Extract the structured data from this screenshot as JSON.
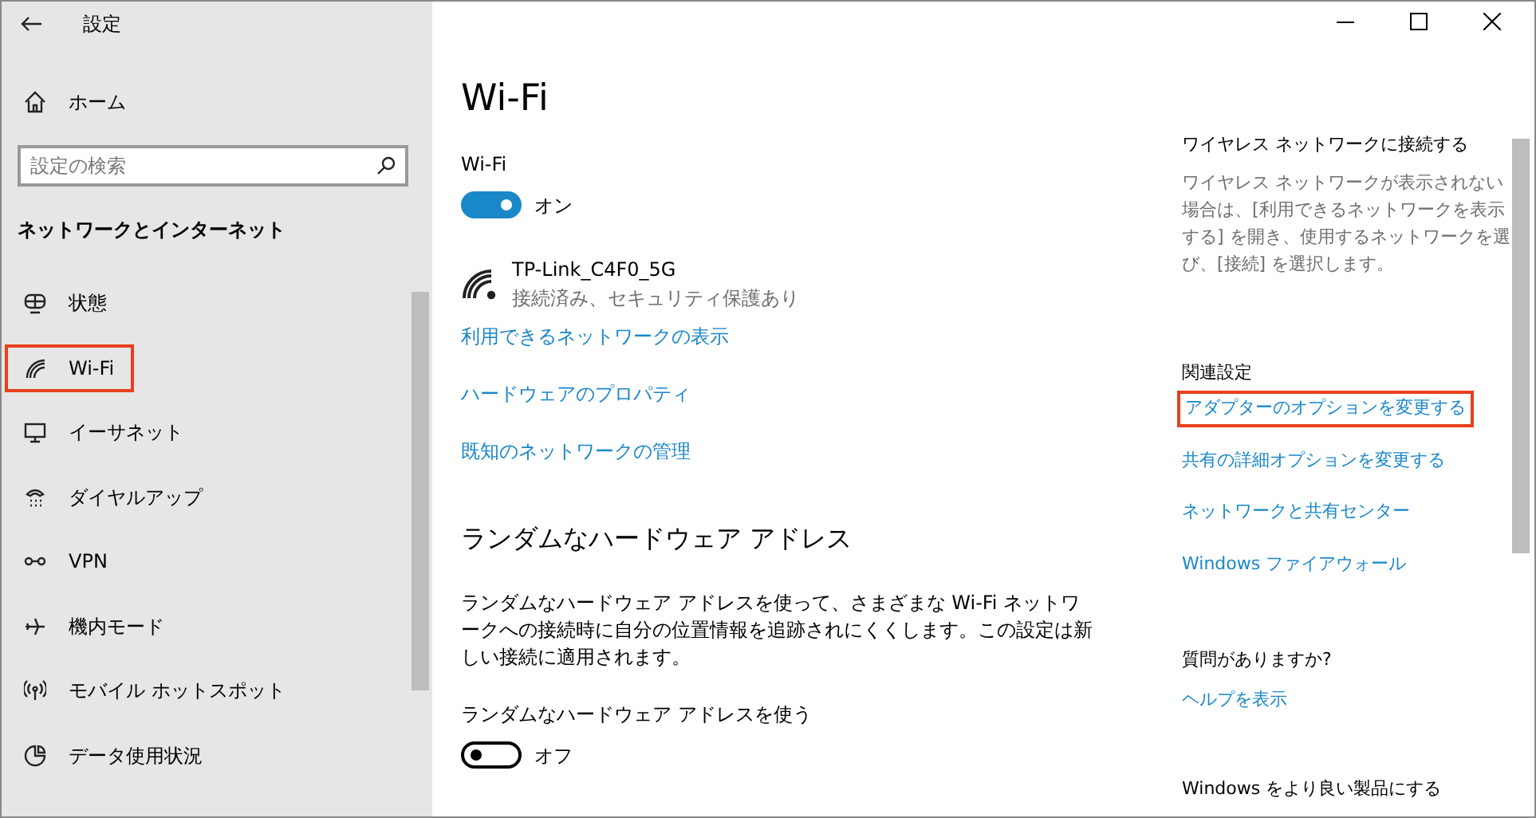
{
  "window": {
    "title": "設定"
  },
  "sidebar": {
    "home": "ホーム",
    "search": {
      "placeholder": "設定の検索"
    },
    "section_title": "ネットワークとインターネット",
    "items": [
      {
        "label": "状態",
        "highlighted": false
      },
      {
        "label": "Wi-Fi",
        "highlighted": true
      },
      {
        "label": "イーサネット",
        "highlighted": false
      },
      {
        "label": "ダイヤルアップ",
        "highlighted": false
      },
      {
        "label": "VPN",
        "highlighted": false
      },
      {
        "label": "機内モード",
        "highlighted": false
      },
      {
        "label": "モバイル ホットスポット",
        "highlighted": false
      },
      {
        "label": "データ使用状況",
        "highlighted": false
      }
    ]
  },
  "main": {
    "title": "Wi-Fi",
    "wifi_toggle": {
      "label": "Wi-Fi",
      "on": true,
      "state_text": "オン"
    },
    "network": {
      "name": "TP-Link_C4F0_5G",
      "status": "接続済み、セキュリティ保護あり"
    },
    "links": [
      "利用できるネットワークの表示",
      "ハードウェアのプロパティ",
      "既知のネットワークの管理"
    ],
    "random_section": {
      "heading": "ランダムなハードウェア アドレス",
      "description": "ランダムなハードウェア アドレスを使って、さまざまな Wi-Fi ネットワークへの接続時に自分の位置情報を追跡されにくくします。この設定は新しい接続に適用されます。",
      "toggle": {
        "label": "ランダムなハードウェア アドレスを使う",
        "on": false,
        "state_text": "オフ"
      }
    }
  },
  "right": {
    "connect": {
      "heading": "ワイヤレス ネットワークに接続する",
      "text": "ワイヤレス ネットワークが表示されない場合は、[利用できるネットワークを表示する] を開き、使用するネットワークを選び、[接続] を選択します。"
    },
    "related": {
      "heading": "関連設定",
      "links": [
        {
          "label": "アダプターのオプションを変更する",
          "highlighted": true
        },
        {
          "label": "共有の詳細オプションを変更する",
          "highlighted": false
        },
        {
          "label": "ネットワークと共有センター",
          "highlighted": false
        },
        {
          "label": "Windows ファイアウォール",
          "highlighted": false
        }
      ]
    },
    "questions": {
      "heading": "質問がありますか?",
      "link": "ヘルプを表示"
    },
    "feedback": {
      "heading": "Windows をより良い製品にする"
    }
  }
}
